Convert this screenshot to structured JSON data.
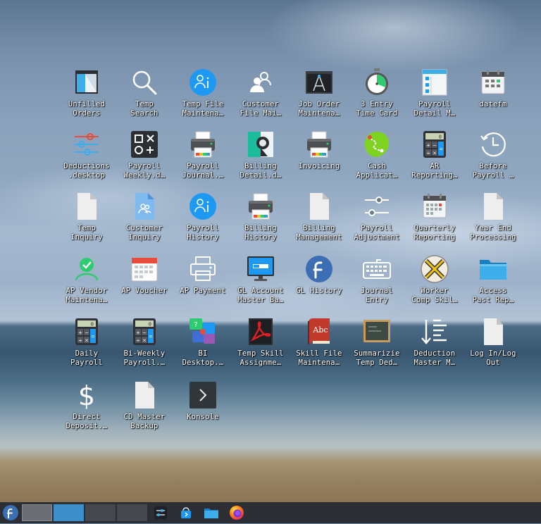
{
  "desktop": {
    "icons": [
      {
        "label": "Unfilled\nOrders",
        "icon": "window-app-icon"
      },
      {
        "label": "Temp\nSearch",
        "icon": "magnifier-icon"
      },
      {
        "label": "Temp File\nMaintena…",
        "icon": "user-info-blue-icon"
      },
      {
        "label": "Customer\nFile Mai…",
        "icon": "people-icon"
      },
      {
        "label": "Job Order\nMaintena…",
        "icon": "compass-drawing-icon"
      },
      {
        "label": "3 Entry\nTime Card",
        "icon": "stopwatch-icon"
      },
      {
        "label": "Payroll\nDetail M…",
        "icon": "checklist-icon"
      },
      {
        "label": "datefm",
        "icon": "calendar-icon"
      },
      {
        "label": "Deductions\n.desktop",
        "icon": "sliders-icon"
      },
      {
        "label": "Payroll\nWeekly.d…",
        "icon": "shapes-icon"
      },
      {
        "label": "Payroll\nJournal.…",
        "icon": "printer-icon"
      },
      {
        "label": "Billing\nDetail.d…",
        "icon": "color-picker-icon"
      },
      {
        "label": "Invoicing",
        "icon": "printer-icon"
      },
      {
        "label": "Cash\nApplicat…",
        "icon": "green-route-icon"
      },
      {
        "label": "AR\nReporting…",
        "icon": "calculator-icon"
      },
      {
        "label": "Before\nPayroll …",
        "icon": "clock-icon"
      },
      {
        "label": "Temp\nInquiry",
        "icon": "blank-file-icon"
      },
      {
        "label": "Customer\nInquiry",
        "icon": "blue-file-icon"
      },
      {
        "label": "Payroll\nHistory",
        "icon": "user-info-blue-icon"
      },
      {
        "label": "Billing\nHistory",
        "icon": "printer-icon"
      },
      {
        "label": "Billing\nManagement",
        "icon": "blank-file-icon"
      },
      {
        "label": "Payroll\nAdjustment",
        "icon": "toggle-sliders-icon"
      },
      {
        "label": "Quarterly\nReporting",
        "icon": "calendar-grid-icon"
      },
      {
        "label": "Year End\nProcessing",
        "icon": "blank-file-icon"
      },
      {
        "label": "AP Vendor\nMaintena…",
        "icon": "user-check-icon"
      },
      {
        "label": "AP Voucher",
        "icon": "calendar-month-icon"
      },
      {
        "label": "AP Payment",
        "icon": "printer-outline-icon"
      },
      {
        "label": "GL Account\nMaster Ba…",
        "icon": "monitor-login-icon"
      },
      {
        "label": "GL History",
        "icon": "fedora-icon"
      },
      {
        "label": "Journal\nEntry",
        "icon": "keyboard-icon"
      },
      {
        "label": "Worker\nComp Skil…",
        "icon": "x-ball-icon"
      },
      {
        "label": "Access\nPast Rep…",
        "icon": "folder-icon"
      },
      {
        "label": "Daily\nPayroll",
        "icon": "calculator-icon"
      },
      {
        "label": "Bi-Weekly\nPayroll.…",
        "icon": "calculator-icon"
      },
      {
        "label": "BI\nDesktop.…",
        "icon": "puzzle-pieces-icon"
      },
      {
        "label": "Temp Skill\nAssignme…",
        "icon": "pdf-viewer-icon"
      },
      {
        "label": "Skill File\nMaintena…",
        "icon": "dictionary-book-icon"
      },
      {
        "label": "Summarizie\nTemp Ded…",
        "icon": "chalkboard-icon"
      },
      {
        "label": "Deduction\nMaster M…",
        "icon": "sort-list-icon"
      },
      {
        "label": "Log In/Log\nOut",
        "icon": "blank-file-icon"
      },
      {
        "label": "Direct\nDeposit.…",
        "icon": "dollar-icon"
      },
      {
        "label": "CD Master\nBackup",
        "icon": "blank-file-icon"
      },
      {
        "label": "Konsole",
        "icon": "terminal-icon"
      }
    ]
  },
  "taskbar": {
    "launcher_icon": "fedora-launcher-icon",
    "desktops": [
      "desktop-1",
      "desktop-2",
      "desktop-3",
      "desktop-4"
    ],
    "apps": [
      {
        "icon": "settings-sliders-icon"
      },
      {
        "icon": "store-bag-icon"
      },
      {
        "icon": "file-manager-icon"
      },
      {
        "icon": "firefox-icon"
      }
    ]
  }
}
